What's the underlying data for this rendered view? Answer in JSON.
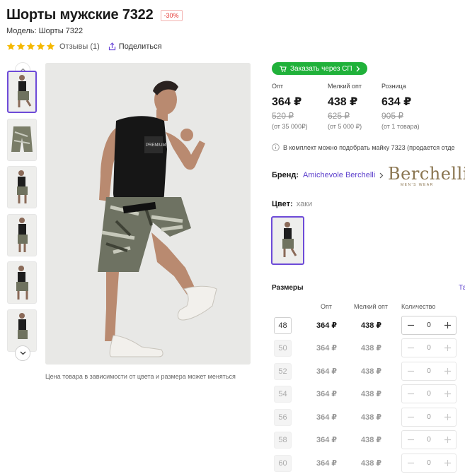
{
  "product": {
    "title": "Шорты мужские 7322",
    "discount_badge": "-30%",
    "model_label": "Модель: Шорты 7322",
    "rating_stars": 5,
    "reviews_label": "Отзывы (1)",
    "share_label": "Поделиться",
    "photo_note": "Цена товара в зависимости от цвета и размера может меняться"
  },
  "sp_button_label": "Заказать через СП",
  "prices": [
    {
      "heading": "Опт",
      "current": "364 ₽",
      "old": "520 ₽",
      "note": "(от 35 000₽)"
    },
    {
      "heading": "Мелкий опт",
      "current": "438 ₽",
      "old": "625 ₽",
      "note": "(от 5 000 ₽)"
    },
    {
      "heading": "Розница",
      "current": "634 ₽",
      "old": "905 ₽",
      "note": "(от 1 товара)"
    }
  ],
  "info_text": "В комплект можно подобрать майку 7323 (продается отде",
  "brand": {
    "label": "Бренд:",
    "name": "Amichevole Berchelli",
    "logo_text": "Berchelli",
    "logo_subtext": "MEN'S WEAR"
  },
  "color": {
    "label": "Цвет:",
    "value": "хаки"
  },
  "sizes": {
    "title": "Размеры",
    "table_link": "Та",
    "col_opt": "Опт",
    "col_small_opt": "Мелкий опт",
    "col_qty": "Количество",
    "rows": [
      {
        "size": "48",
        "opt": "364 ₽",
        "small_opt": "438 ₽",
        "qty": "0",
        "available": true
      },
      {
        "size": "50",
        "opt": "364 ₽",
        "small_opt": "438 ₽",
        "qty": "0",
        "available": false
      },
      {
        "size": "52",
        "opt": "364 ₽",
        "small_opt": "438 ₽",
        "qty": "0",
        "available": false
      },
      {
        "size": "54",
        "opt": "364 ₽",
        "small_opt": "438 ₽",
        "qty": "0",
        "available": false
      },
      {
        "size": "56",
        "opt": "364 ₽",
        "small_opt": "438 ₽",
        "qty": "0",
        "available": false
      },
      {
        "size": "58",
        "opt": "364 ₽",
        "small_opt": "438 ₽",
        "qty": "0",
        "available": false
      },
      {
        "size": "60",
        "opt": "364 ₽",
        "small_opt": "438 ₽",
        "qty": "0",
        "available": false
      }
    ]
  },
  "colors": {
    "accent": "#6d4ad8",
    "sp_green": "#20b13a",
    "star": "#f5b800",
    "discount": "#e53935"
  }
}
